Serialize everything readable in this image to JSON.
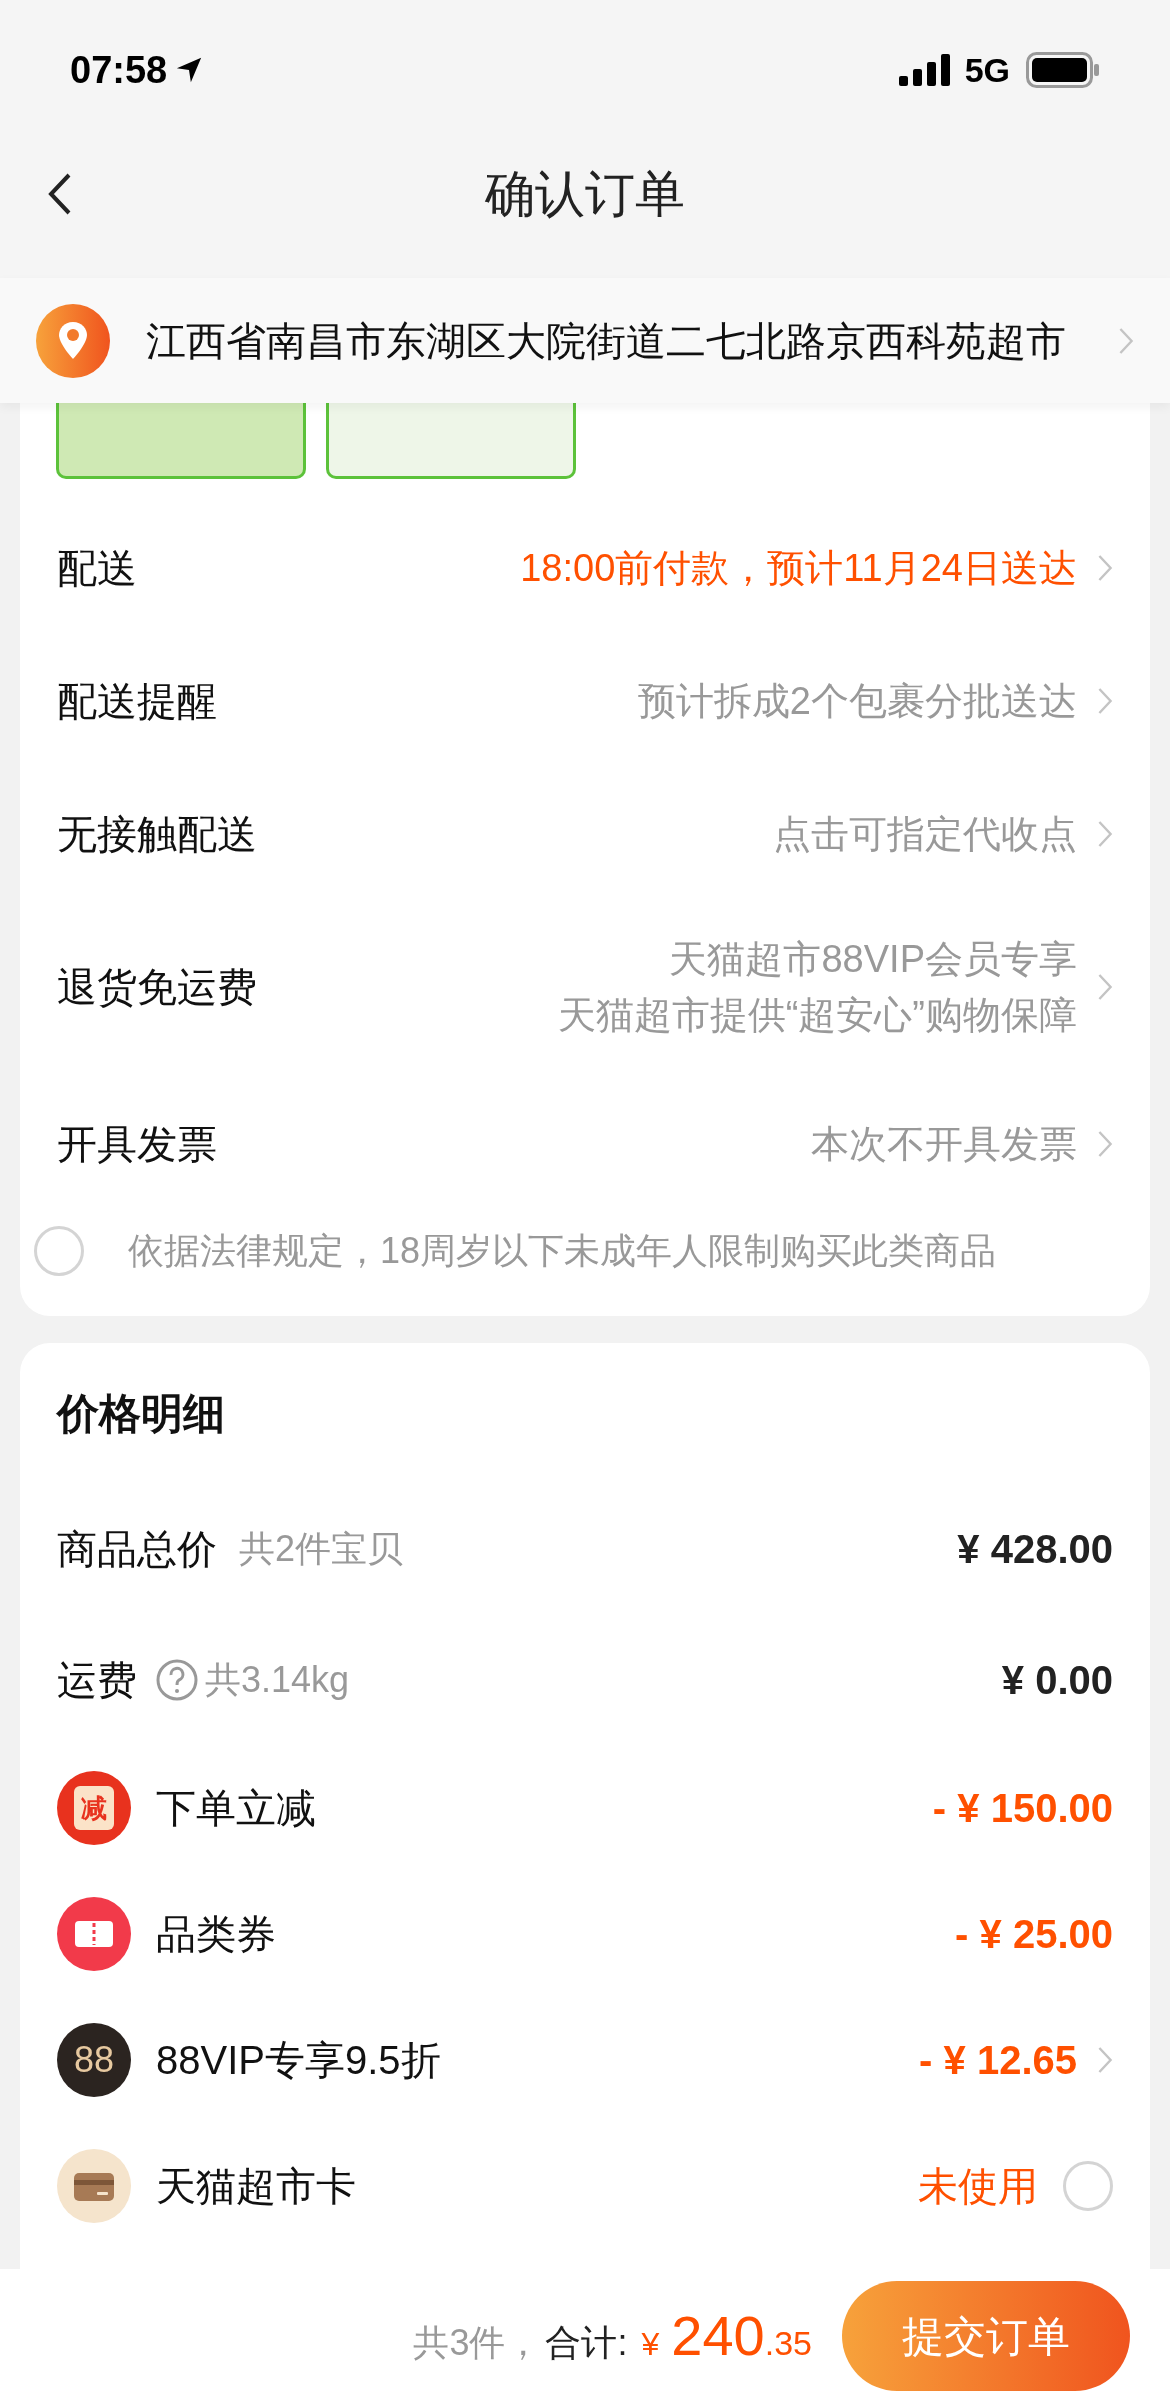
{
  "status_bar": {
    "time": "07:58",
    "network": "5G"
  },
  "nav": {
    "title": "确认订单"
  },
  "address": {
    "text": "江西省南昌市东湖区大院街道二七北路京西科苑超市"
  },
  "order_rows": [
    {
      "label": "配送",
      "values": [
        "18:00前付款，预计11月24日送达"
      ],
      "highlight": true
    },
    {
      "label": "配送提醒",
      "values": [
        "预计拆成2个包裹分批送达"
      ],
      "highlight": false
    },
    {
      "label": "无接触配送",
      "values": [
        "点击可指定代收点"
      ],
      "highlight": false
    },
    {
      "label": "退货免运费",
      "values": [
        "天猫超市88VIP会员专享",
        "天猫超市提供“超安心”购物保障"
      ],
      "highlight": false
    },
    {
      "label": "开具发票",
      "values": [
        "本次不开具发票"
      ],
      "highlight": false
    }
  ],
  "age_notice": {
    "text": "依据法律规定，18周岁以下未成年人限制购买此类商品",
    "checked": false
  },
  "price_detail": {
    "title": "价格明细",
    "rows": [
      {
        "kind": "line",
        "label": "商品总价",
        "note": "共2件宝贝",
        "help": false,
        "amount": "¥ 428.00"
      },
      {
        "kind": "line",
        "label": "运费",
        "note": "共3.14kg",
        "help": true,
        "amount": "¥ 0.00"
      },
      {
        "kind": "reduce",
        "badge_text": "减",
        "label": "下单立减",
        "amount": "- ¥ 150.00",
        "chevron": false
      },
      {
        "kind": "coupon",
        "label": "品类券",
        "amount": "- ¥ 25.00",
        "chevron": false
      },
      {
        "kind": "vip",
        "badge_text": "88",
        "label": "88VIP专享9.5折",
        "amount": "- ¥ 12.65",
        "chevron": true
      },
      {
        "kind": "card",
        "label": "天猫超市卡",
        "amount": "未使用",
        "checked": false
      }
    ]
  },
  "footer": {
    "count": "共3件，",
    "total_label": "合计:",
    "currency": "¥",
    "amount_int": "240",
    "amount_dec": ".35",
    "submit": "提交订单"
  }
}
